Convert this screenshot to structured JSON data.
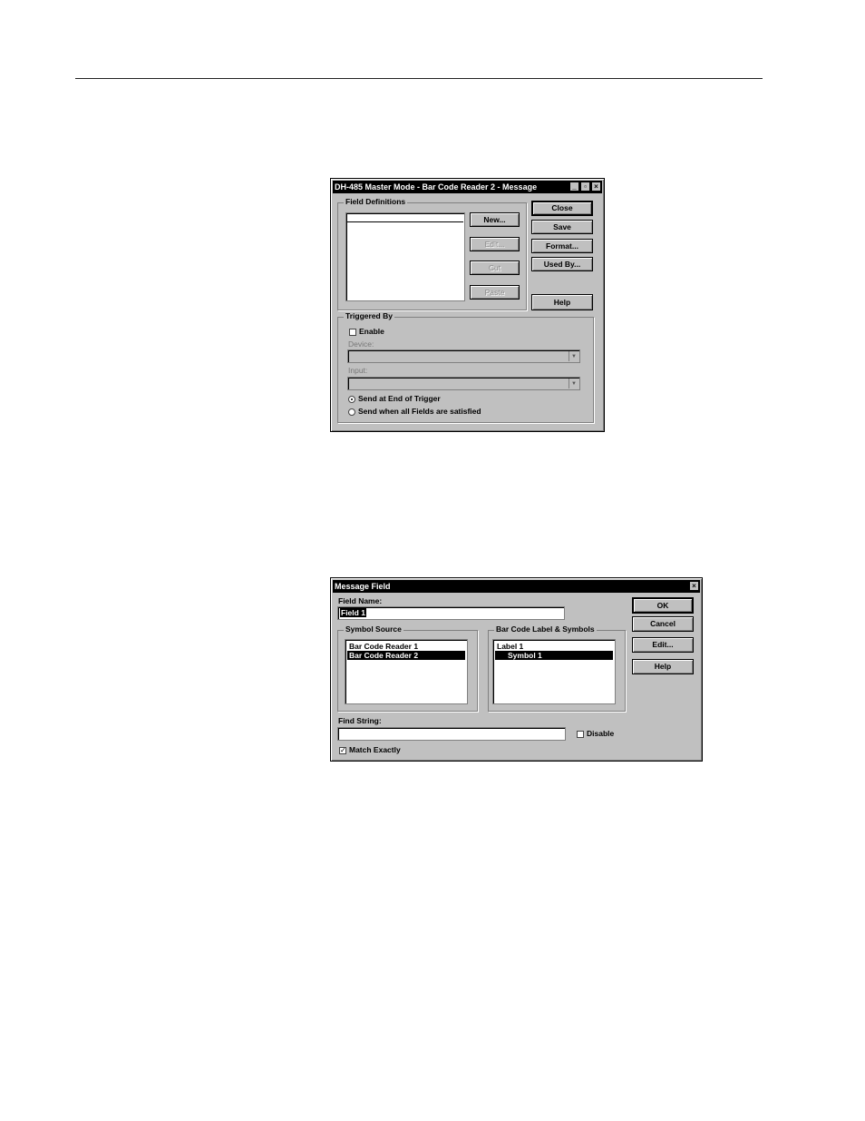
{
  "dialog1": {
    "title": "DH-485 Master Mode - Bar Code Reader 2 - Message",
    "field_definitions_label": "Field Definitions",
    "buttons": {
      "new": "New...",
      "edit": "Edit...",
      "cut": "Cut",
      "paste": "Paste",
      "close": "Close",
      "save": "Save",
      "format": "Format...",
      "used_by": "Used By...",
      "help": "Help"
    },
    "triggered_by": {
      "label": "Triggered By",
      "enable_label": "Enable",
      "enable_checked": false,
      "device_label": "Device:",
      "device_value": "",
      "input_label": "Input:",
      "input_value": "",
      "radio_end_of_trigger": "Send at End of Trigger",
      "radio_all_fields": "Send when all Fields are satisfied",
      "selected_radio": "end_of_trigger"
    }
  },
  "dialog2": {
    "title": "Message Field",
    "field_name_label": "Field Name:",
    "field_name_value": "Field 1",
    "symbol_source_label": "Symbol Source",
    "symbol_source_items": [
      "Bar Code Reader 1",
      "Bar Code Reader 2"
    ],
    "symbol_source_selected": 1,
    "label_symbols_label": "Bar Code Label & Symbols",
    "label_symbols_items": [
      "Label 1",
      "Symbol 1"
    ],
    "label_symbols_selected": 1,
    "find_string_label": "Find String:",
    "find_string_value": "",
    "disable_label": "Disable",
    "disable_checked": false,
    "match_exactly_label": "Match Exactly",
    "match_exactly_checked": true,
    "buttons": {
      "ok": "OK",
      "cancel": "Cancel",
      "edit": "Edit...",
      "help": "Help"
    }
  }
}
